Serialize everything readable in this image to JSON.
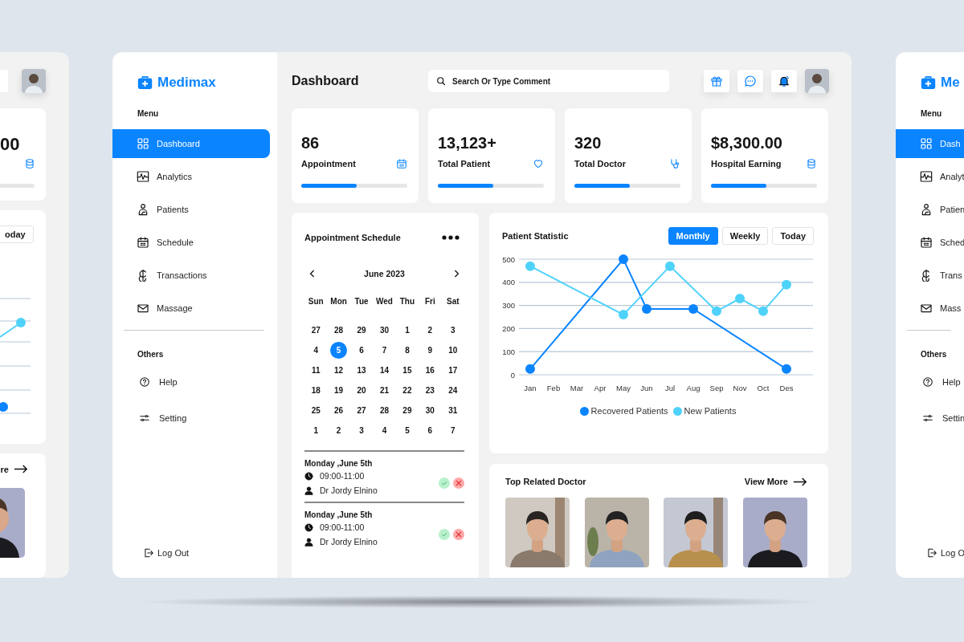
{
  "left_copy": {
    "stat_value": "00",
    "filter_button": "oday",
    "link": "re"
  },
  "sidebar": {
    "logo": "Medimax",
    "menu_heading": "Menu",
    "menu": [
      {
        "label": "Dashboard",
        "selected": true
      },
      {
        "label": "Analytics",
        "selected": false
      },
      {
        "label": "Patients",
        "selected": false
      },
      {
        "label": "Schedule",
        "selected": false
      },
      {
        "label": "Transactions",
        "selected": false
      },
      {
        "label": "Massage",
        "selected": false
      }
    ],
    "others_heading": "Others",
    "others": [
      {
        "label": "Help",
        "selected": false
      },
      {
        "label": "Setting",
        "selected": false
      }
    ],
    "logout": "Log Out"
  },
  "header": {
    "title": "Dashboard",
    "search": {
      "placeholder": "Search Or Type Comment"
    }
  },
  "stats": [
    {
      "value": "86",
      "label": "Appointment",
      "level": 0.52
    },
    {
      "value": "13,123+",
      "label": "Total Patient",
      "level": 0.52
    },
    {
      "value": "320",
      "label": "Total Doctor",
      "level": 0.52
    },
    {
      "value": "$8,300.00",
      "label": "Hospital Earning",
      "level": 0.52
    }
  ],
  "schedule": {
    "title": "Appointment Schedule",
    "month": "June 2023",
    "weekdays": [
      "Sun",
      "Mon",
      "Tue",
      "Wed",
      "Thu",
      "Fri",
      "Sat"
    ],
    "weeks": [
      [
        {
          "day": "27",
          "selected": false
        },
        {
          "day": "28",
          "selected": false
        },
        {
          "day": "29",
          "selected": false
        },
        {
          "day": "30",
          "selected": false
        },
        {
          "day": "1",
          "selected": false
        },
        {
          "day": "2",
          "selected": false
        },
        {
          "day": "3",
          "selected": false
        }
      ],
      [
        {
          "day": "4",
          "selected": false
        },
        {
          "day": "5",
          "selected": true
        },
        {
          "day": "6",
          "selected": false
        },
        {
          "day": "7",
          "selected": false
        },
        {
          "day": "8",
          "selected": false
        },
        {
          "day": "9",
          "selected": false
        },
        {
          "day": "10",
          "selected": false
        }
      ],
      [
        {
          "day": "11",
          "selected": false
        },
        {
          "day": "12",
          "selected": false
        },
        {
          "day": "13",
          "selected": false
        },
        {
          "day": "14",
          "selected": false
        },
        {
          "day": "15",
          "selected": false
        },
        {
          "day": "16",
          "selected": false
        },
        {
          "day": "17",
          "selected": false
        }
      ],
      [
        {
          "day": "18",
          "selected": false
        },
        {
          "day": "19",
          "selected": false
        },
        {
          "day": "20",
          "selected": false
        },
        {
          "day": "21",
          "selected": false
        },
        {
          "day": "22",
          "selected": false
        },
        {
          "day": "23",
          "selected": false
        },
        {
          "day": "24",
          "selected": false
        }
      ],
      [
        {
          "day": "25",
          "selected": false
        },
        {
          "day": "26",
          "selected": false
        },
        {
          "day": "27",
          "selected": false
        },
        {
          "day": "28",
          "selected": false
        },
        {
          "day": "29",
          "selected": false
        },
        {
          "day": "30",
          "selected": false
        },
        {
          "day": "31",
          "selected": false
        }
      ],
      [
        {
          "day": "1",
          "selected": false
        },
        {
          "day": "2",
          "selected": false
        },
        {
          "day": "3",
          "selected": false
        },
        {
          "day": "4",
          "selected": false
        },
        {
          "day": "5",
          "selected": false
        },
        {
          "day": "6",
          "selected": false
        },
        {
          "day": "7",
          "selected": false
        }
      ]
    ],
    "appointments": [
      {
        "date": "Monday ,June 5th",
        "time": "09:00-11:00",
        "doctor": "Dr Jordy Elnino"
      },
      {
        "date": "Monday ,June 5th",
        "time": "09:00-11:00",
        "doctor": "Dr Jordy Elnino"
      }
    ]
  },
  "statistic": {
    "title": "Patient Statistic",
    "periods": [
      {
        "label": "Monthly",
        "selected": true
      },
      {
        "label": "Weekly",
        "selected": false
      },
      {
        "label": "Today",
        "selected": false
      }
    ],
    "chart_data": {
      "type": "line",
      "grid": true,
      "categories": [
        "Jan",
        "Feb",
        "Mar",
        "Apr",
        "May",
        "Jun",
        "Jul",
        "Aug",
        "Sep",
        "Nov",
        "Oct",
        "Des"
      ],
      "ylim": [
        0,
        500
      ],
      "yticks": [
        0,
        100,
        200,
        300,
        400,
        500
      ],
      "series": [
        {
          "name": "Recovered Patients",
          "color": "#0a84ff",
          "marker": "circle",
          "values": [
            25,
            null,
            null,
            null,
            500,
            285,
            null,
            285,
            null,
            null,
            null,
            25
          ]
        },
        {
          "name": "New Patients",
          "color": "#4fd2fa",
          "marker": "circle",
          "values": [
            470,
            null,
            null,
            null,
            260,
            null,
            470,
            null,
            275,
            330,
            275,
            390
          ]
        }
      ]
    }
  },
  "doctors": {
    "title": "Top Related Doctor",
    "link": "View More"
  },
  "right_copy": {
    "logo": "Me",
    "menu_heading": "Menu",
    "menu": [
      {
        "label": "Dash",
        "selected": true
      },
      {
        "label": "Analyt",
        "selected": false
      },
      {
        "label": "Patien",
        "selected": false
      },
      {
        "label": "Sched",
        "selected": false
      },
      {
        "label": "Trans",
        "selected": false
      },
      {
        "label": "Mass",
        "selected": false
      }
    ],
    "others_heading": "Others",
    "others": [
      {
        "label": "Help",
        "selected": false
      },
      {
        "label": "Settin",
        "selected": false
      }
    ],
    "logout": "Log O"
  }
}
